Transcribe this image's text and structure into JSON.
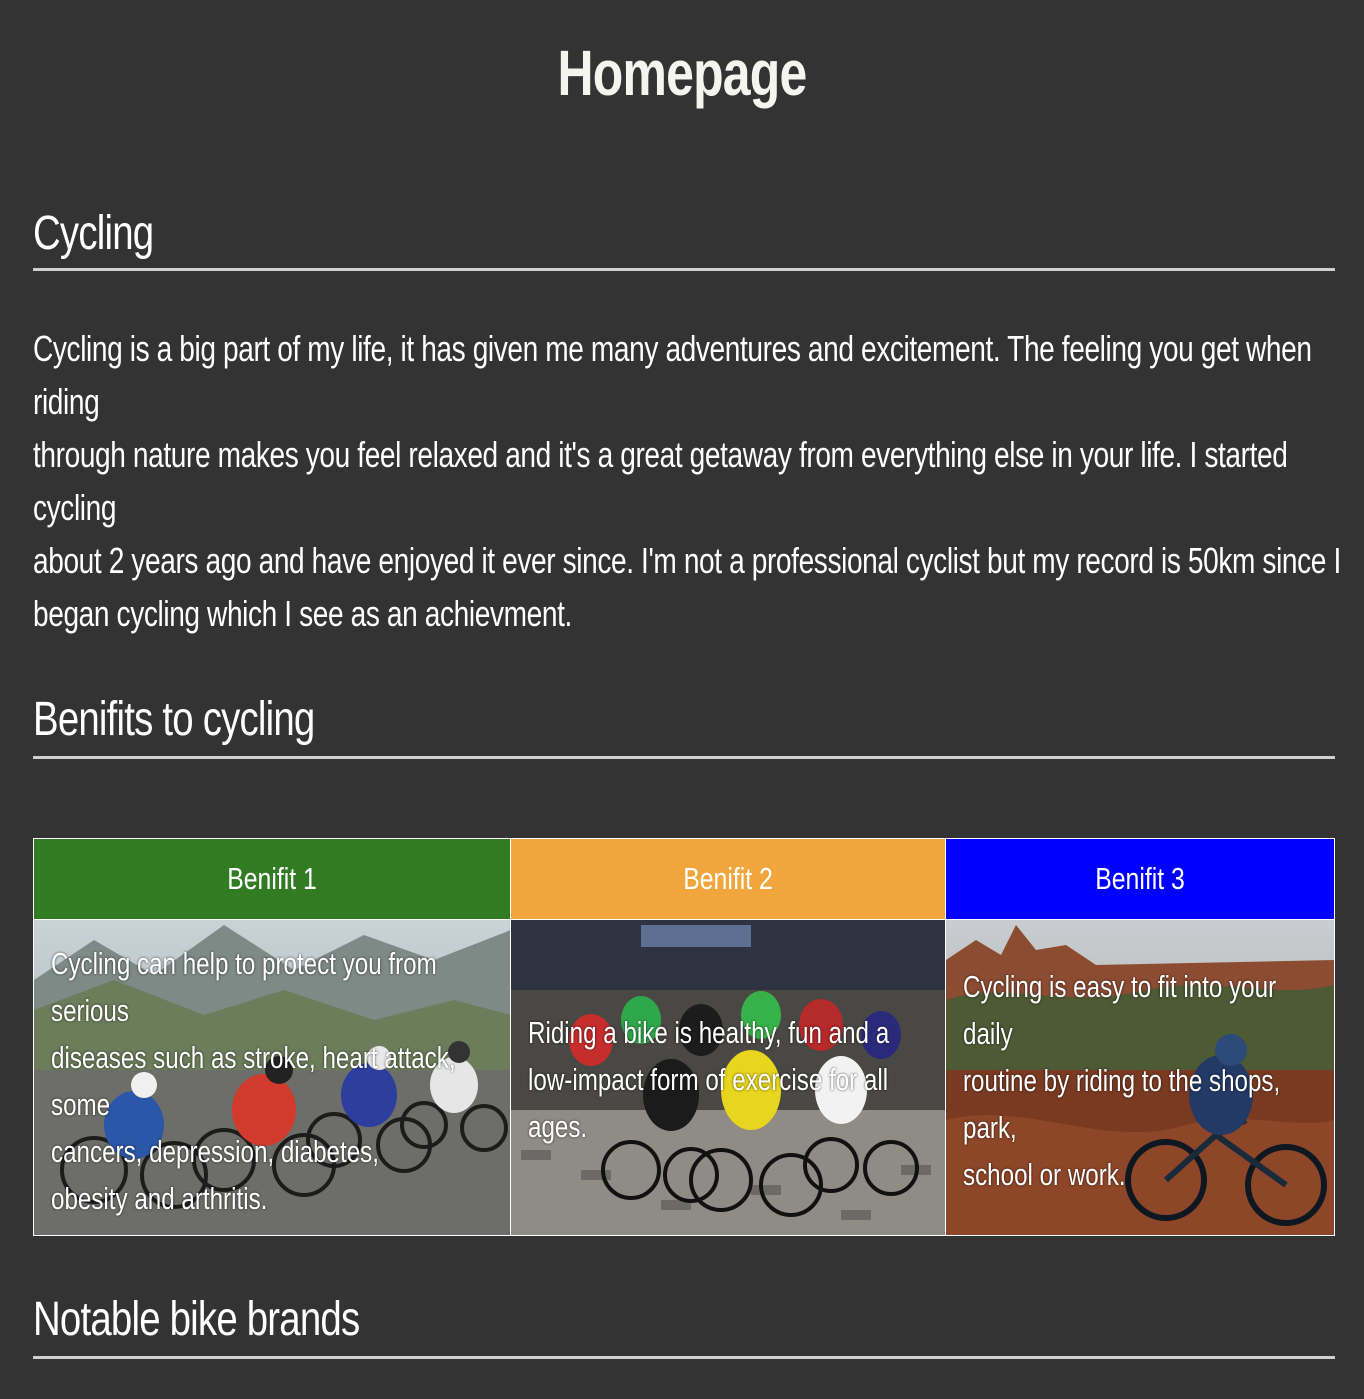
{
  "page": {
    "title": "Homepage"
  },
  "sections": {
    "cycling": {
      "heading": "Cycling",
      "paragraph_lines": [
        "Cycling is a big part of my life, it has given me many adventures and excitement. The feeling you get when",
        "riding",
        "through nature makes you feel relaxed and it's a great getaway from everything else in your life. I started",
        "cycling",
        "about 2 years ago and have enjoyed it ever since. I'm not a professional cyclist but my record is 50km since I",
        "began cycling which I see as an achievment."
      ]
    },
    "benefits": {
      "heading": "Benifits to cycling"
    },
    "brands": {
      "heading": "Notable bike brands"
    }
  },
  "benefits_table": {
    "headers": [
      {
        "label": "Benifit 1",
        "color": "#317c22"
      },
      {
        "label": "Benifit 2",
        "color": "#f0a63c"
      },
      {
        "label": "Benifit 3",
        "color": "#0000ff"
      }
    ],
    "cells": [
      {
        "image": "cycling-peloton-mountains-photo",
        "lines": [
          "Cycling can help to protect you from",
          "serious",
          "diseases such as stroke, heart attack,",
          "some",
          "cancers, depression, diabetes,",
          "obesity and arthritis."
        ]
      },
      {
        "image": "cycling-race-cobblestones-photo",
        "lines": [
          "Riding a bike is healthy, fun and a",
          "low-impact form of exercise for all",
          "ages."
        ]
      },
      {
        "image": "mountain-biker-red-trail-photo",
        "lines": [
          "Cycling is easy to fit into your",
          "daily",
          "routine by riding to the shops,",
          "park,",
          "school or work."
        ]
      }
    ]
  }
}
